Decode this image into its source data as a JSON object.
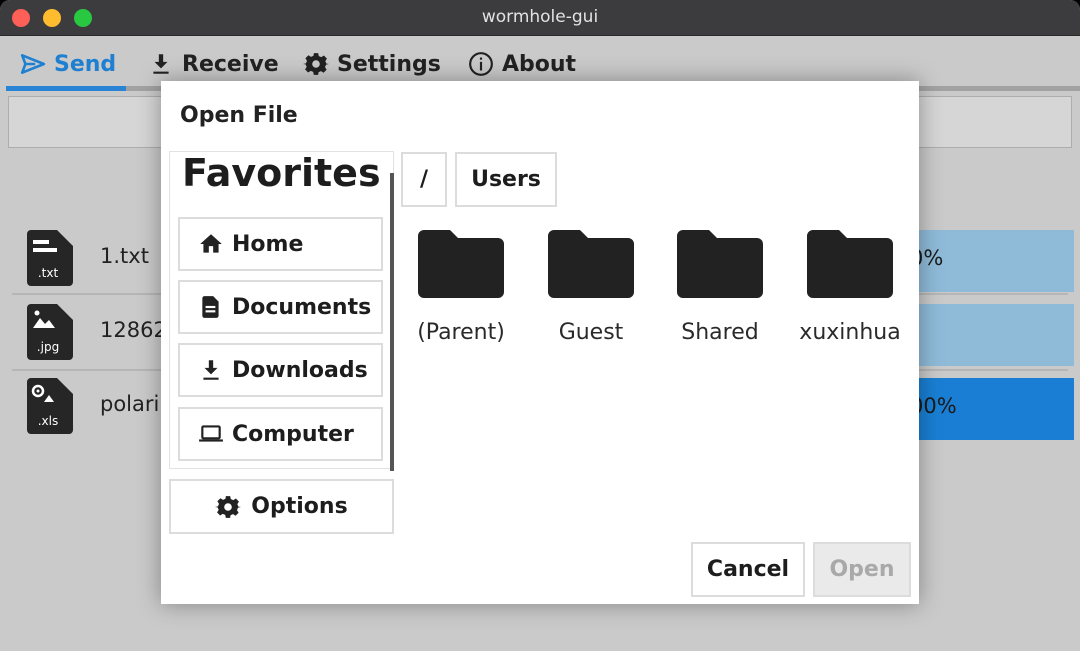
{
  "window": {
    "title": "wormhole-gui"
  },
  "tabs": [
    {
      "label": "Send",
      "icon": "send-icon",
      "active": true
    },
    {
      "label": "Receive",
      "icon": "download-icon"
    },
    {
      "label": "Settings",
      "icon": "gear-icon"
    },
    {
      "label": "About",
      "icon": "info-icon"
    }
  ],
  "background_files": [
    {
      "ext": ".txt",
      "name": "1.txt",
      "progress_text": "0%",
      "progress_color": "#8fbbd9"
    },
    {
      "ext": ".jpg",
      "name": "12862",
      "progress_text": "",
      "progress_color": "#8fbbd9"
    },
    {
      "ext": ".xls",
      "name": "polari",
      "progress_text": "00%",
      "progress_color": "#1a7fd4"
    }
  ],
  "dialog": {
    "title": "Open File",
    "favorites_heading": "Favorites",
    "favorites": [
      {
        "label": "Home",
        "icon": "home-icon"
      },
      {
        "label": "Documents",
        "icon": "document-icon"
      },
      {
        "label": "Downloads",
        "icon": "download-icon"
      },
      {
        "label": "Computer",
        "icon": "laptop-icon"
      }
    ],
    "options_label": "Options",
    "breadcrumb": [
      "/",
      "Users"
    ],
    "folders": [
      "(Parent)",
      "Guest",
      "Shared",
      "xuxinhua"
    ],
    "cancel_label": "Cancel",
    "open_label": "Open"
  },
  "colors": {
    "accent": "#1f7fd0",
    "titlebar": "#3c3b3d",
    "progress_active": "#1a7fd4",
    "progress_idle": "#8fbbd9"
  }
}
